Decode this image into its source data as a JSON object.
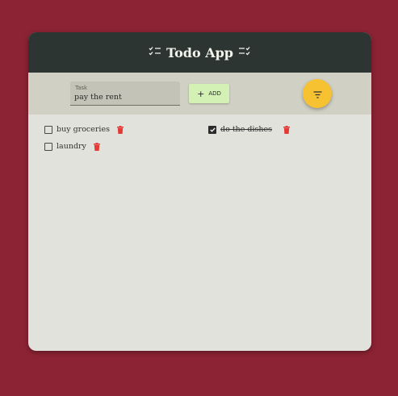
{
  "header": {
    "title": "Todo App",
    "left_glyph": "☑☰",
    "right_glyph": "☰☑"
  },
  "form": {
    "task_label": "Task",
    "task_value": "pay the rent",
    "add_label": "ADD",
    "add_icon": "plus-icon",
    "filter_icon": "filter-icon"
  },
  "todos": [
    {
      "text": "buy groceries",
      "done": false
    },
    {
      "text": "laundry",
      "done": false
    },
    {
      "text": "do the dishes",
      "done": true
    }
  ],
  "colors": {
    "background": "#8b2334",
    "header": "#2d3532",
    "toolbar": "#d0d1c4",
    "add_button": "#d3f1b5",
    "filter_button": "#f6c232",
    "delete": "#e53935"
  }
}
